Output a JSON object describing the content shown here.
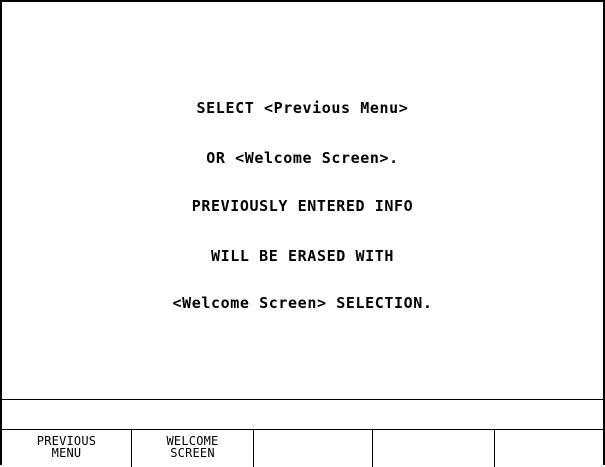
{
  "message": {
    "lines": [
      "SELECT <Previous Menu>",
      "OR <Welcome Screen>.",
      "PREVIOUSLY ENTERED INFO",
      "WILL BE ERASED WITH",
      "<Welcome Screen> SELECTION."
    ]
  },
  "status": {
    "text": ""
  },
  "softkeys": [
    {
      "line1": "PREVIOUS",
      "line2": "MENU"
    },
    {
      "line1": "WELCOME",
      "line2": "SCREEN"
    },
    {
      "line1": "",
      "line2": ""
    },
    {
      "line1": "",
      "line2": ""
    },
    {
      "line1": "",
      "line2": ""
    }
  ]
}
